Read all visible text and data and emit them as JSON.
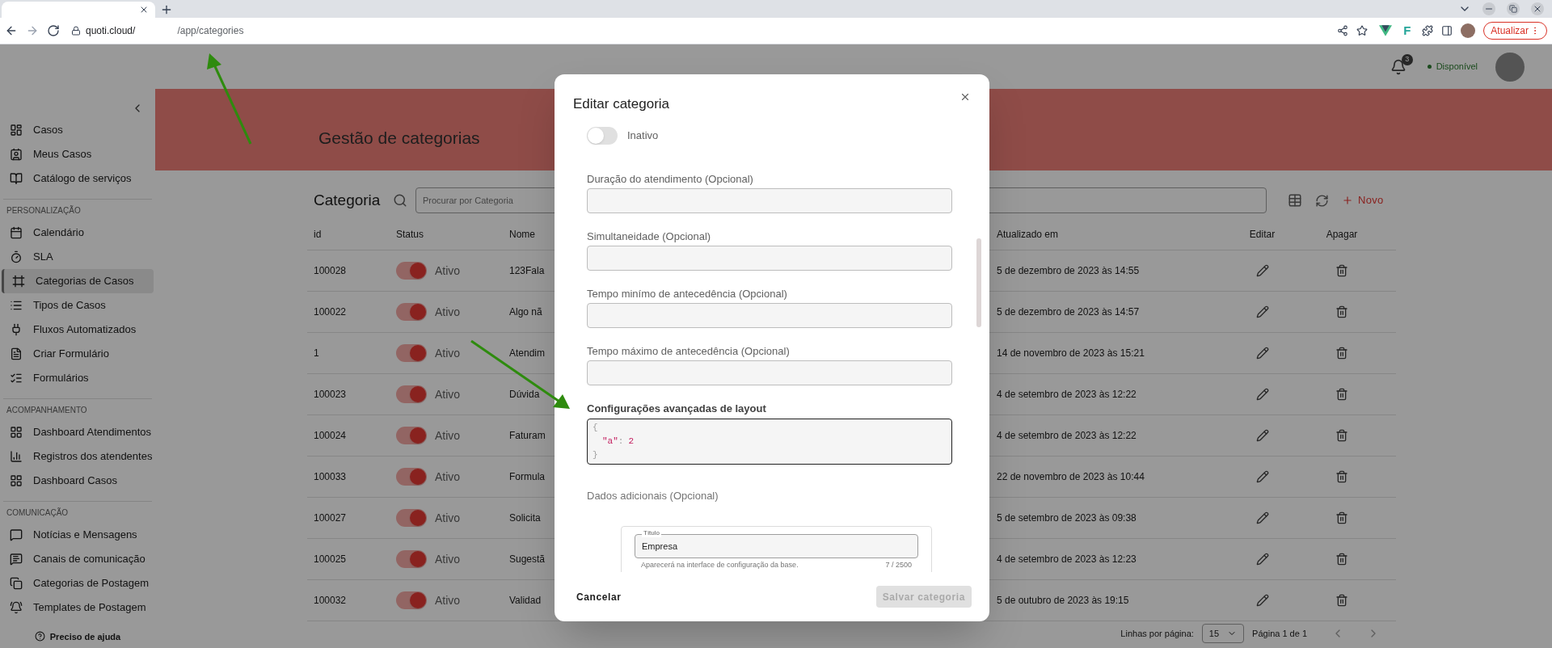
{
  "browser": {
    "url_host": "quoti.cloud/",
    "url_path": "/app/categories",
    "extension_letter": "F",
    "update_button": "Atualizar"
  },
  "header": {
    "notification_count": "3",
    "status": "Disponível"
  },
  "sidebar": {
    "sections": [
      {
        "items": [
          {
            "label": "Casos",
            "selected": false
          },
          {
            "label": "Meus Casos",
            "selected": false
          },
          {
            "label": "Catálogo de serviços",
            "selected": false
          }
        ]
      },
      {
        "heading": "PERSONALIZAÇÃO",
        "items": [
          {
            "label": "Calendário",
            "selected": false
          },
          {
            "label": "SLA",
            "selected": false
          },
          {
            "label": "Categorias de Casos",
            "selected": true
          },
          {
            "label": "Tipos de Casos",
            "selected": false
          },
          {
            "label": "Fluxos Automatizados",
            "selected": false
          },
          {
            "label": "Criar Formulário",
            "selected": false
          },
          {
            "label": "Formulários",
            "selected": false
          }
        ]
      },
      {
        "heading": "ACOMPANHAMENTO",
        "items": [
          {
            "label": "Dashboard Atendimentos",
            "selected": false
          },
          {
            "label": "Registros dos atendentes",
            "selected": false
          },
          {
            "label": "Dashboard Casos",
            "selected": false
          }
        ]
      },
      {
        "heading": "COMUNICAÇÃO",
        "items": [
          {
            "label": "Notícias e Mensagens",
            "selected": false
          },
          {
            "label": "Canais de comunicação",
            "selected": false
          },
          {
            "label": "Categorias de Postagem",
            "selected": false
          },
          {
            "label": "Templates de Postagem",
            "selected": false
          }
        ]
      }
    ],
    "help": "Preciso de ajuda"
  },
  "page": {
    "title": "Gestão de categorias"
  },
  "table": {
    "title": "Categoria",
    "search_placeholder": "Procurar por Categoria",
    "new_button": "Novo",
    "columns": [
      "id",
      "Status",
      "Nome",
      "Atualizado em",
      "Editar",
      "Apagar"
    ],
    "rows": [
      {
        "id": "100028",
        "status": {
          "on": true,
          "label": "Ativo"
        },
        "name": "123Fala",
        "updated": "5 de dezembro de 2023 às 14:55"
      },
      {
        "id": "100022",
        "status": {
          "on": true,
          "label": "Ativo"
        },
        "name": "Algo nã",
        "updated": "5 de dezembro de 2023 às 14:57"
      },
      {
        "id": "1",
        "status": {
          "on": true,
          "label": "Ativo"
        },
        "name": "Atendim",
        "updated": "14 de novembro de 2023 às 15:21"
      },
      {
        "id": "100023",
        "status": {
          "on": true,
          "label": "Ativo"
        },
        "name": "Dúvida",
        "updated": "4 de setembro de 2023 às 12:22"
      },
      {
        "id": "100024",
        "status": {
          "on": true,
          "label": "Ativo"
        },
        "name": "Faturam",
        "updated": "4 de setembro de 2023 às 12:22"
      },
      {
        "id": "100033",
        "status": {
          "on": true,
          "label": "Ativo"
        },
        "name": "Formula",
        "updated": "22 de novembro de 2023 às 10:44"
      },
      {
        "id": "100027",
        "status": {
          "on": true,
          "label": "Ativo"
        },
        "name": "Solicita",
        "updated": "5 de setembro de 2023 às 09:38"
      },
      {
        "id": "100025",
        "status": {
          "on": true,
          "label": "Ativo"
        },
        "name": "Sugestã",
        "updated": "4 de setembro de 2023 às 12:23"
      },
      {
        "id": "100032",
        "status": {
          "on": true,
          "label": "Ativo"
        },
        "name": "Validad",
        "updated": "5 de outubro de 2023 às 19:15"
      }
    ]
  },
  "pagination": {
    "rows_label": "Linhas por página:",
    "rows_value": "15",
    "page_label": "Página 1 de 1"
  },
  "modal": {
    "title": "Editar categoria",
    "status": {
      "on": false,
      "label": "Inativo"
    },
    "fields": [
      {
        "label": "Duração do atendimento (Opcional)"
      },
      {
        "label": "Simultaneidade (Opcional)"
      },
      {
        "label": "Tempo minímo de antecedência (Opcional)"
      },
      {
        "label": "Tempo máximo de antecedência (Opcional)"
      }
    ],
    "layout_config": {
      "label": "Configurações avançadas de layout",
      "lines": [
        [
          {
            "kind": "punct",
            "text": "{"
          }
        ],
        [
          {
            "kind": "key",
            "text": "\"a\""
          },
          {
            "kind": "punct",
            "text": ":"
          },
          {
            "kind": "number",
            "text": "2"
          }
        ],
        [
          {
            "kind": "punct",
            "text": "}"
          }
        ]
      ]
    },
    "extra_data": {
      "label": "Dados adicionais (Opcional)",
      "field_label": "Título",
      "field_value": "Empresa",
      "helper": "Aparecerá na interface de configuração da base.",
      "counter": "7 / 2500"
    },
    "cancel_button": "Cancelar",
    "save_button": {
      "label": "Salvar categoria",
      "disabled": true
    }
  }
}
